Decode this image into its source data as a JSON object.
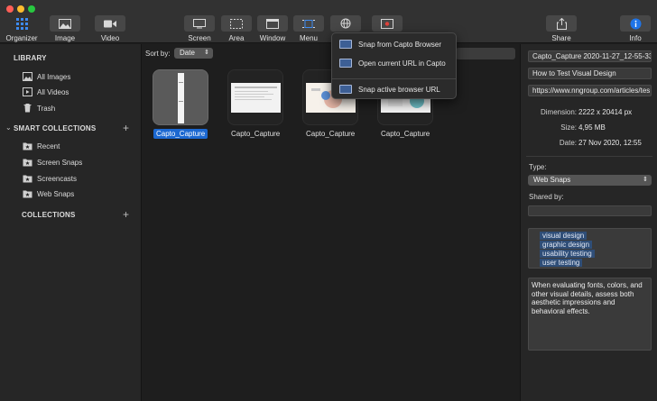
{
  "toolbar": {
    "buttons": [
      {
        "label": "Organizer",
        "icon": "grid-icon"
      },
      {
        "label": "Image",
        "icon": "image-icon"
      },
      {
        "label": "Video",
        "icon": "video-camera-icon"
      },
      {
        "label": "Screen",
        "icon": "screen-icon"
      },
      {
        "label": "Area",
        "icon": "area-select-icon"
      },
      {
        "label": "Window",
        "icon": "window-icon"
      },
      {
        "label": "Menu",
        "icon": "menu-capture-icon"
      },
      {
        "label": "Share",
        "icon": "share-icon"
      },
      {
        "label": "Info",
        "icon": "info-icon"
      }
    ],
    "accent": "#1b68d1"
  },
  "sidebar": {
    "library_header": "LIBRARY",
    "library_items": [
      {
        "label": "All Images",
        "icon": "images-icon"
      },
      {
        "label": "All Videos",
        "icon": "videos-icon"
      },
      {
        "label": "Trash",
        "icon": "trash-icon"
      }
    ],
    "smart_header": "SMART COLLECTIONS",
    "smart_items": [
      {
        "label": "Recent",
        "icon": "smart-folder-icon"
      },
      {
        "label": "Screen Snaps",
        "icon": "smart-folder-icon"
      },
      {
        "label": "Screencasts",
        "icon": "smart-folder-icon"
      },
      {
        "label": "Web Snaps",
        "icon": "smart-folder-icon"
      }
    ],
    "collections_header": "COLLECTIONS",
    "plus": "+"
  },
  "main": {
    "sort_label": "Sort by:",
    "sort_value": "Date",
    "thumbnails": [
      {
        "label": "Capto_Capture",
        "selected": true
      },
      {
        "label": "Capto_Capture",
        "selected": false
      },
      {
        "label": "Capto_Capture",
        "selected": false
      },
      {
        "label": "Capto_Capture",
        "selected": false
      }
    ]
  },
  "menu": {
    "items": [
      "Snap from Capto Browser",
      "Open current URL in Capto",
      "Snap active browser URL"
    ]
  },
  "inspector": {
    "filename": "Capto_Capture 2020-11-27_12-55-33",
    "title": "How to Test Visual Design",
    "url": "https://www.nngroup.com/articles/tes",
    "dimension_key": "Dimension:",
    "dimension_val": "2222 x 20414 px",
    "size_key": "Size:",
    "size_val": "4,95 MB",
    "date_key": "Date:",
    "date_val": "27 Nov 2020, 12:55",
    "type_label": "Type:",
    "type_value": "Web Snaps",
    "shared_label": "Shared by:",
    "tags": [
      "visual design",
      "graphic design",
      "usability testing",
      "user testing"
    ],
    "notes": "When evaluating fonts, colors, and other visual details, assess both aesthetic impressions and behavioral effects."
  }
}
